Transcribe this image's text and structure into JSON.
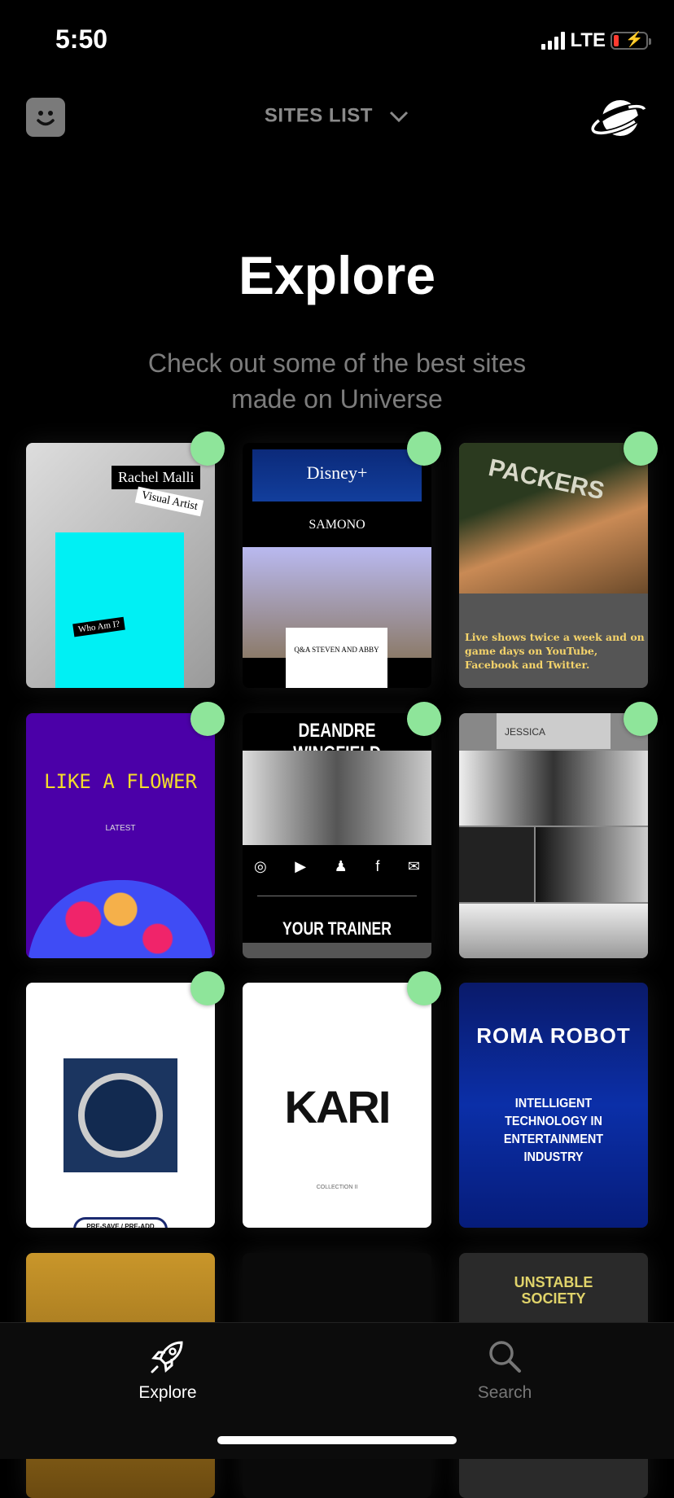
{
  "status": {
    "time": "5:50",
    "network": "LTE",
    "battery_level": 0.1,
    "charging": true
  },
  "header": {
    "avatar_icon": "smiley-face-icon",
    "dropdown_label": "SITES LIST",
    "dropdown_icon": "chevron-down-icon",
    "right_icon": "planet-icon"
  },
  "main": {
    "title": "Explore",
    "subtitle": "Check out some of the best sites made on Universe"
  },
  "accent": {
    "dot": "#8ee59a"
  },
  "sites": [
    {
      "name": "Rachel Malli",
      "line": "Visual Artist",
      "extra": "Who Am I?",
      "has_dot": true
    },
    {
      "name": "SAMONO",
      "line": "Q&A STEVEN AND ABBY",
      "extra": "Disney+",
      "has_dot": true
    },
    {
      "name": "Packers",
      "line": "Live shows twice a week and on game days on YouTube, Facebook and Twitter.",
      "has_dot": true
    },
    {
      "name": "LIKE A FLOWER",
      "line": "LATEST",
      "has_dot": true
    },
    {
      "name": "DEANDRE WINGFIELD",
      "line": "YOUR TRAINER",
      "has_dot": true
    },
    {
      "name": "JESSICA",
      "line": "",
      "has_dot": true
    },
    {
      "name": "PRE-SAVE / PRE-ADD",
      "line": "",
      "has_dot": true
    },
    {
      "name": "KARI",
      "line": "COLLECTION II",
      "has_dot": true
    },
    {
      "name": "ROMA ROBOT",
      "line": "INTELLIGENT TECHNOLOGY IN ENTERTAINMENT INDUSTRY",
      "has_dot": false
    },
    {
      "name": "",
      "line": "",
      "has_dot": false
    },
    {
      "name": "",
      "line": "",
      "has_dot": false
    },
    {
      "name": "UNSTABLE SOCIETY",
      "line": "",
      "has_dot": false
    }
  ],
  "tabs": [
    {
      "label": "Explore",
      "icon": "rocket-icon",
      "active": true
    },
    {
      "label": "Search",
      "icon": "search-icon",
      "active": false
    }
  ]
}
